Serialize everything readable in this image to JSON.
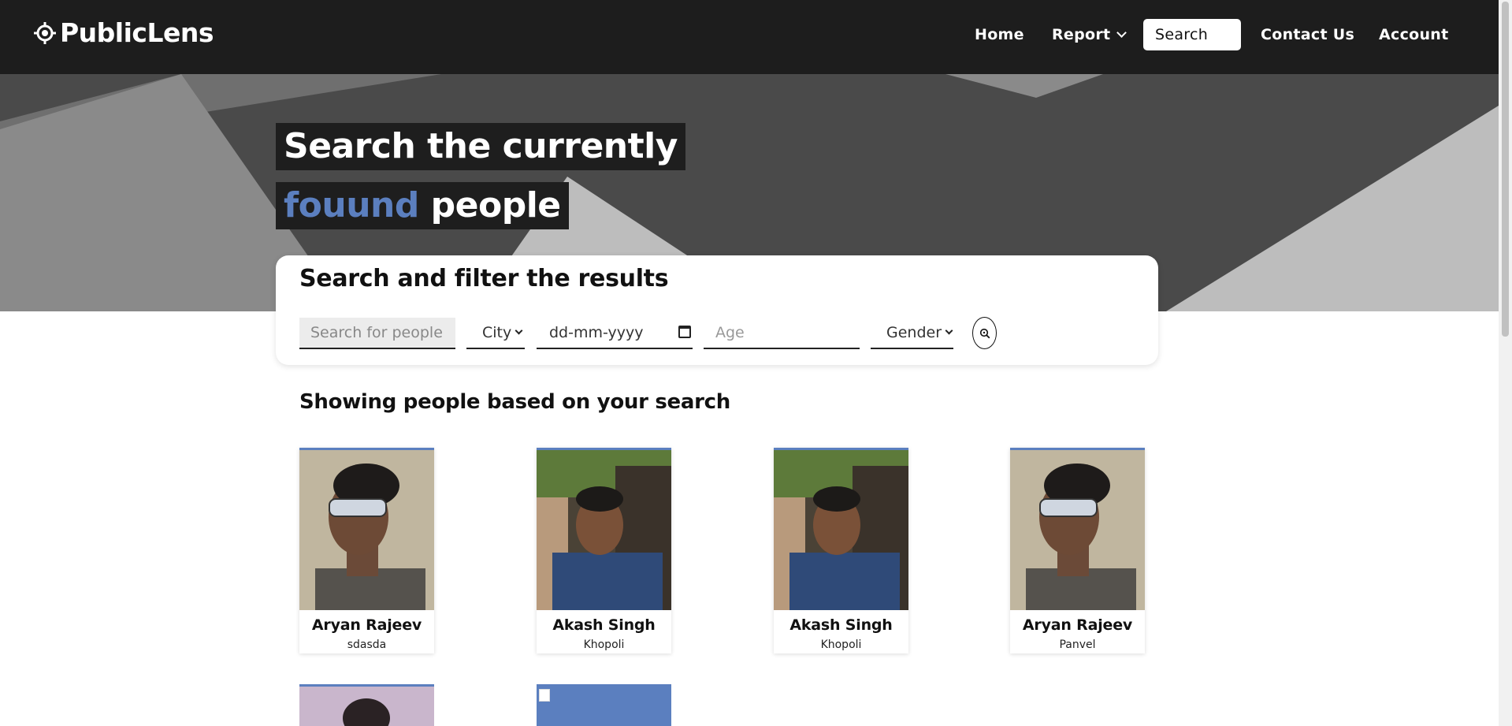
{
  "app": {
    "name": "PublicLens"
  },
  "nav": {
    "home": "Home",
    "report": "Report",
    "search": "Search",
    "contact": "Contact Us",
    "account": "Account"
  },
  "hero": {
    "line1": "Search the currently",
    "line2_accent": "fouund",
    "line2_rest": " people",
    "accent_color": "#5b7fbf"
  },
  "filter": {
    "title": "Search and filter the results",
    "search_placeholder": "Search for people",
    "city_label": "City",
    "date_placeholder": "dd-mm-yyyy",
    "age_placeholder": "Age",
    "gender_label": "Gender"
  },
  "results": {
    "title": "Showing people based on your search",
    "people": [
      {
        "name": "Aryan Rajeev",
        "city": "sdasda"
      },
      {
        "name": "Akash Singh",
        "city": "Khopoli"
      },
      {
        "name": "Akash Singh",
        "city": "Khopoli"
      },
      {
        "name": "Aryan Rajeev",
        "city": "Panvel"
      }
    ]
  }
}
